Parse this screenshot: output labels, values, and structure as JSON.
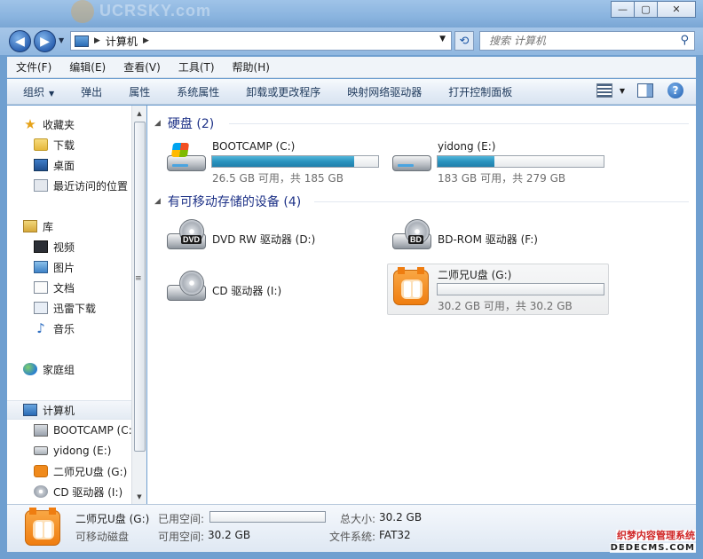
{
  "titlebar": {
    "watermark_logo": "UCRSKY.com",
    "window_buttons": {
      "minimize": "—",
      "maximize": "▢",
      "close": "✕"
    }
  },
  "address": {
    "crumbs": [
      "计算机"
    ],
    "search_placeholder": "搜索 计算机"
  },
  "menubar": {
    "items": [
      "文件(F)",
      "编辑(E)",
      "查看(V)",
      "工具(T)",
      "帮助(H)"
    ]
  },
  "commandbar": {
    "items": [
      "组织",
      "弹出",
      "属性",
      "系统属性",
      "卸载或更改程序",
      "映射网络驱动器",
      "打开控制面板"
    ]
  },
  "navpane": {
    "favorites": {
      "label": "收藏夹",
      "items": [
        "下载",
        "桌面",
        "最近访问的位置"
      ]
    },
    "libraries": {
      "label": "库",
      "items": [
        "视频",
        "图片",
        "文档",
        "迅雷下载",
        "音乐"
      ]
    },
    "homegroup": {
      "label": "家庭组"
    },
    "computer": {
      "label": "计算机",
      "items": [
        "BOOTCAMP (C:)",
        "yidong (E:)",
        "二师兄U盘 (G:)",
        "CD 驱动器 (I:)"
      ]
    }
  },
  "content": {
    "hard_disks": {
      "header": "硬盘 (2)",
      "drives": [
        {
          "name": "BOOTCAMP (C:)",
          "usage": "26.5 GB 可用，共 185 GB",
          "used_fraction": 0.857
        },
        {
          "name": "yidong (E:)",
          "usage": "183 GB 可用，共 279 GB",
          "used_fraction": 0.344
        }
      ]
    },
    "removable": {
      "header": "有可移动存储的设备 (4)",
      "devices": [
        {
          "name": "DVD RW 驱动器 (D:)",
          "badge": "DVD"
        },
        {
          "name": "BD-ROM 驱动器 (F:)",
          "badge": "BD"
        },
        {
          "name": "CD 驱动器 (I:)"
        },
        {
          "name": "二师兄U盘 (G:)",
          "usage": "30.2 GB 可用，共 30.2 GB",
          "used_fraction": 0.0
        }
      ]
    }
  },
  "details": {
    "name": "二师兄U盘 (G:)",
    "type": "可移动磁盘",
    "used_label": "已用空间:",
    "free_label": "可用空间:",
    "free_value": "30.2 GB",
    "total_label": "总大小:",
    "total_value": "30.2 GB",
    "fs_label": "文件系统:",
    "fs_value": "FAT32"
  },
  "site_watermark": {
    "cn": "织梦内容管理系统",
    "en": "DEDECMS.COM"
  },
  "colors": {
    "accent_fill": "#2a93bf",
    "usb_orange": "#ef7d10",
    "group_header": "#1e3287"
  }
}
